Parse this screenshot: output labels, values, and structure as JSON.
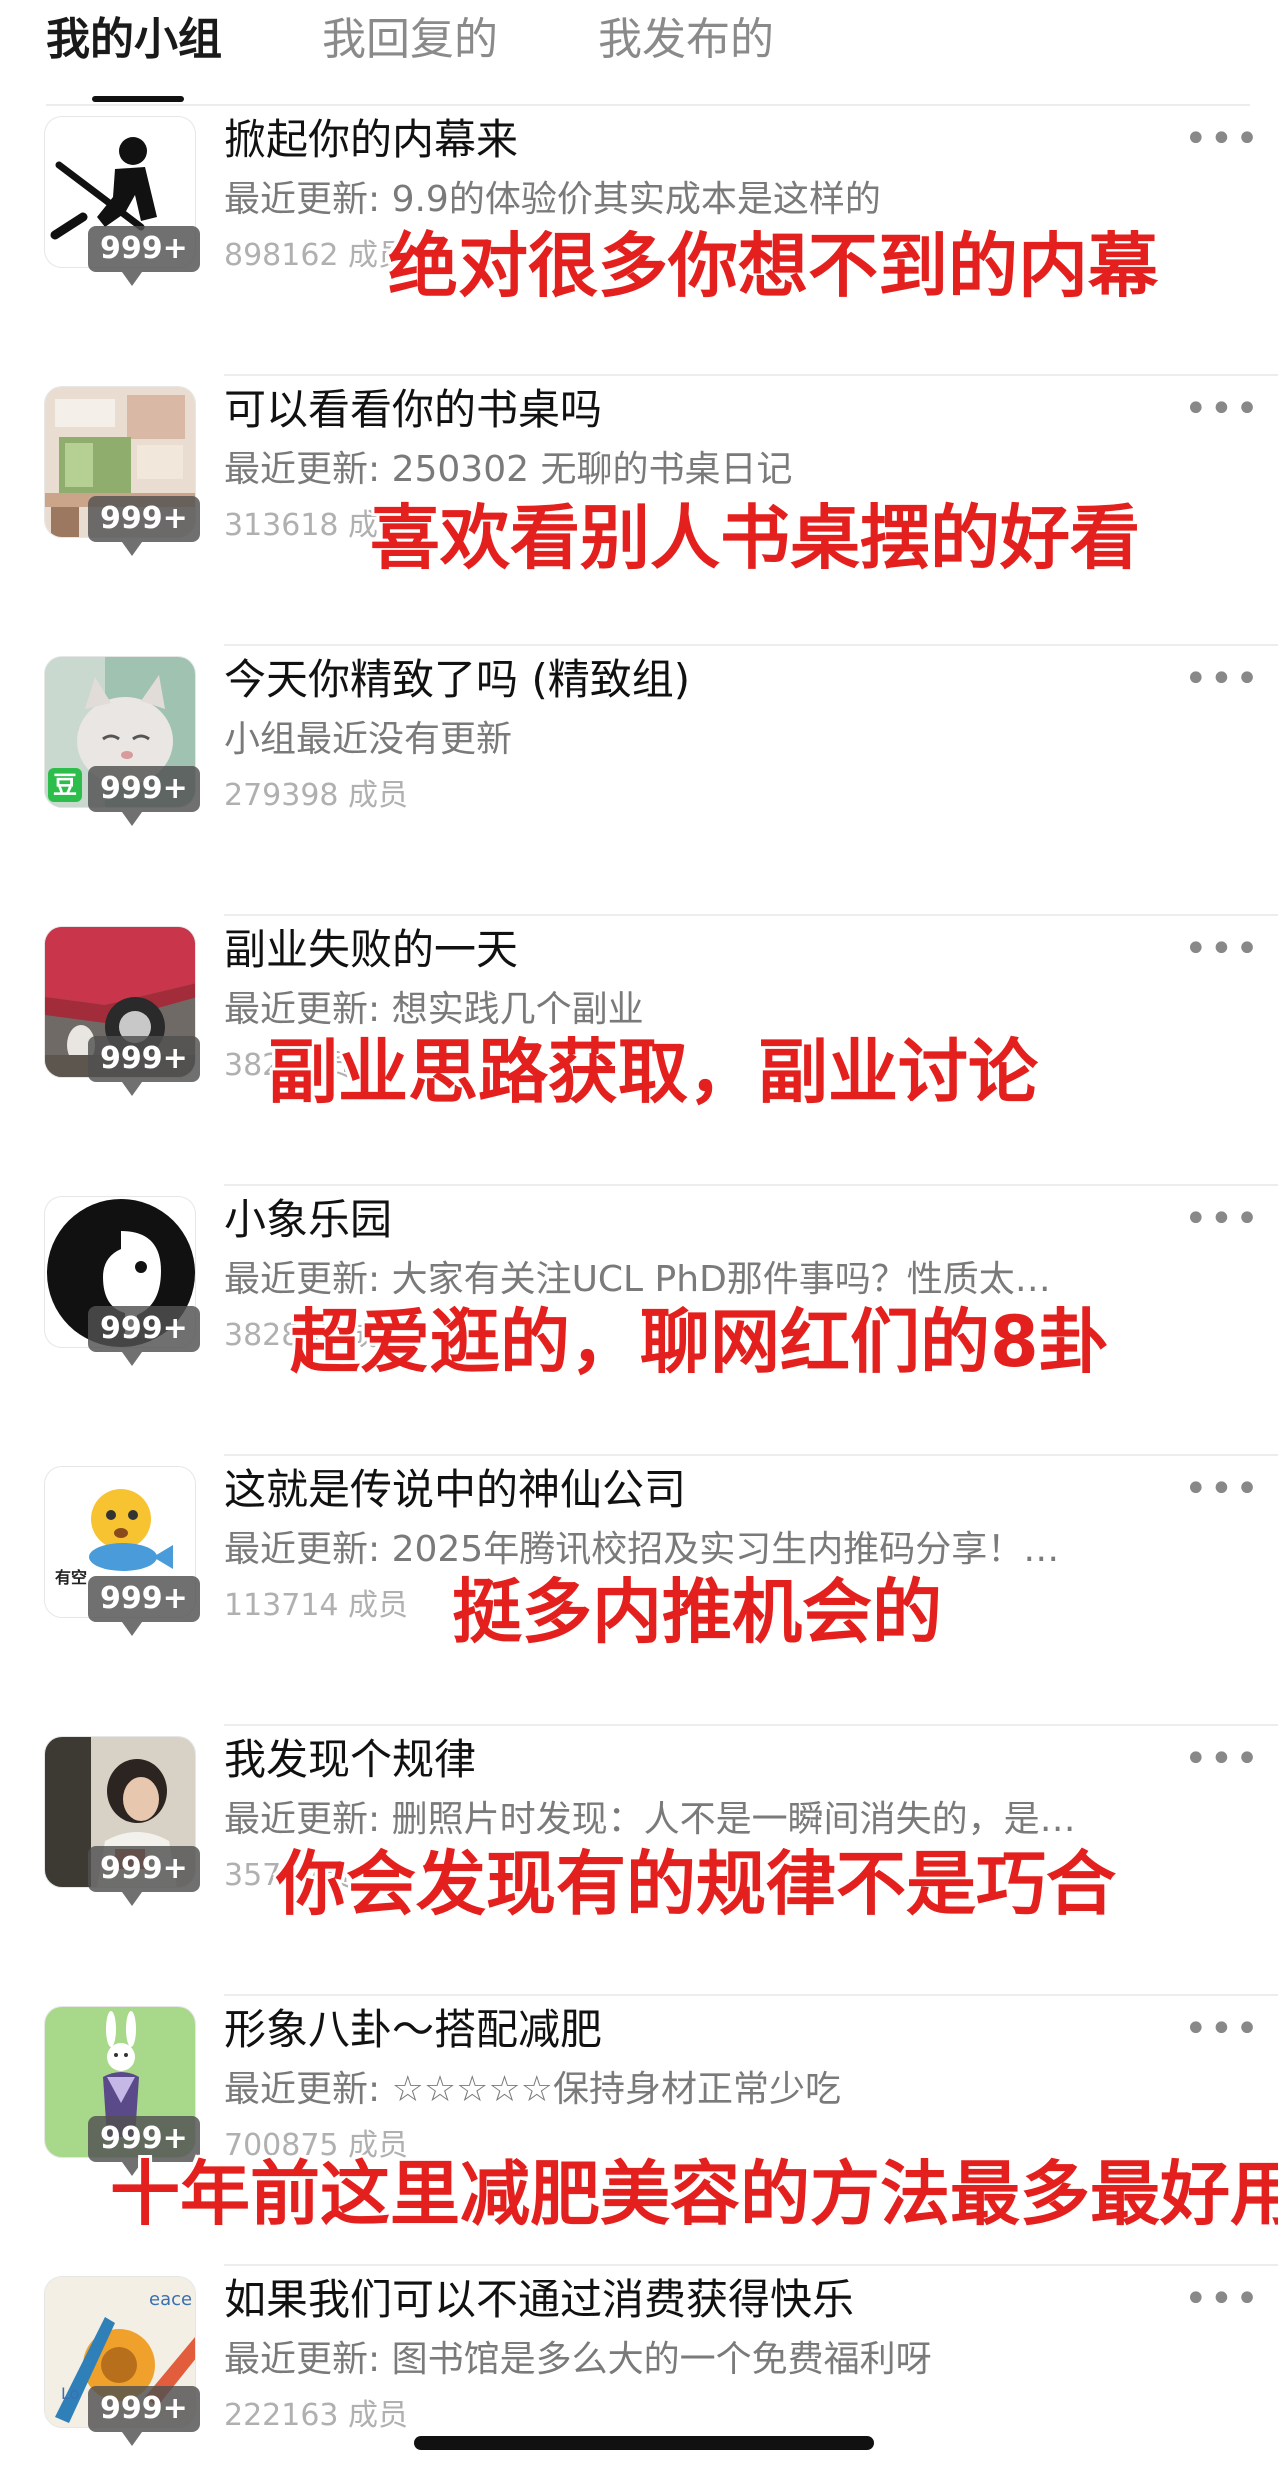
{
  "tabs": [
    {
      "label": "我的小组",
      "active": true
    },
    {
      "label": "我回复的",
      "active": false
    },
    {
      "label": "我发布的",
      "active": false
    }
  ],
  "count_badge": "999+",
  "more_glyph": "•••",
  "groups": [
    {
      "name": "掀起你的内幕来",
      "update": "最近更新: 9.9的体验价其实成本是这样的",
      "members": "898162 成员",
      "caption": "绝对很多你想不到的内幕",
      "avatar_icon": "worker-shovel-icon"
    },
    {
      "name": "可以看看你的书桌吗",
      "update": "最近更新: 250302 无聊的书桌日记",
      "members": "313618 成员",
      "caption": "喜欢看别人书桌摆的好看",
      "avatar_icon": "desk-photo-icon"
    },
    {
      "name": "今天你精致了吗 (精致组)",
      "update": "小组最近没有更新",
      "members": "279398 成员",
      "caption": "",
      "avatar_icon": "cat-photo-icon",
      "douban_badge": "豆"
    },
    {
      "name": "副业失败的一天",
      "update": "最近更新: 想实践几个副业",
      "members": "382 成员",
      "caption": "副业思路获取，副业讨论",
      "avatar_icon": "car-cat-photo-icon"
    },
    {
      "name": "小象乐园",
      "update": "最近更新: 大家有关注UCL PhD那件事吗？性质太…",
      "members": "382865 成员",
      "caption": "超爱逛的，聊网红们的8卦",
      "avatar_icon": "elephant-logo-icon"
    },
    {
      "name": "这就是传说中的神仙公司",
      "update": "最近更新: 2025年腾讯校招及实习生内推码分享！…",
      "members": "113714 成员",
      "caption": "挺多内推机会的",
      "avatar_icon": "fish-emoji-icon",
      "avatar_text": "有空"
    },
    {
      "name": "我发现个规律",
      "update": "最近更新: 删照片时发现：人不是一瞬间消失的，是…",
      "members": "357 成员",
      "caption": "你会发现有的规律不是巧合",
      "avatar_icon": "woman-photo-icon"
    },
    {
      "name": "形象八卦～搭配减肥",
      "update": "最近更新: ☆☆☆☆☆保持身材正常少吃",
      "members": "700875 成员",
      "caption": "十年前这里减肥美容的方法最多最好用",
      "avatar_icon": "rabbit-figure-icon"
    },
    {
      "name": "如果我们可以不通过消费获得快乐",
      "update": "最近更新: 图书馆是多么大的一个免费福利呀",
      "members": "222163 成员",
      "caption": "",
      "avatar_icon": "peace-love-art-icon",
      "avatar_text_a": "eace",
      "avatar_text_b": "Lo"
    }
  ]
}
